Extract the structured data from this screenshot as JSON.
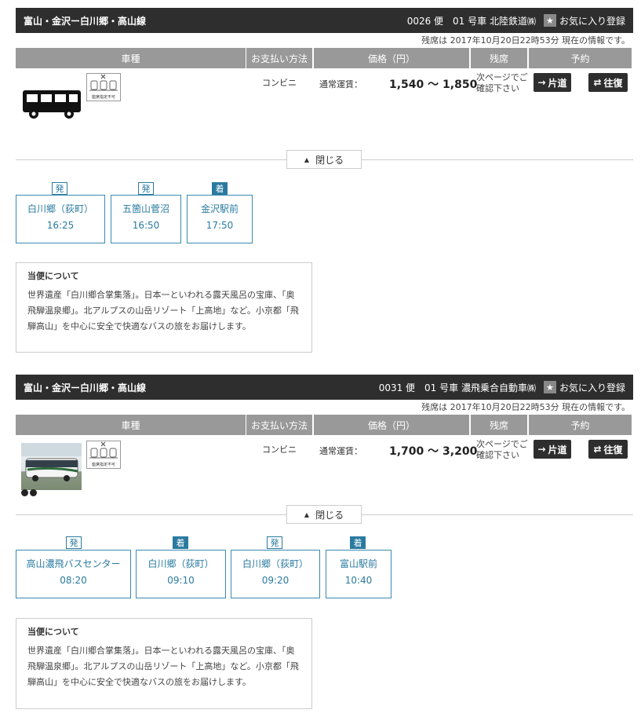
{
  "common": {
    "fav_label": "お気に入り登録",
    "fav_star": "★",
    "col_vehicle": "車種",
    "col_payment": "お支払い方法",
    "col_price": "価格（円）",
    "col_seats": "残席",
    "col_booking": "予約",
    "payment": "コンビニ",
    "fare_label": "通常運賃：",
    "seat_note": "次ページでご確認下さい",
    "oneway_label": "片道",
    "roundtrip_label": "往復",
    "close_label": "閉じる",
    "seat_icon_text": "座席指定不可",
    "about_title": "当便について",
    "about_text": "世界遺産「白川郷合掌集落」。日本一といわれる露天風呂の宝庫、「奥飛騨温泉郷」。北アルプスの山岳リゾート「上高地」など。小京都「飛騨高山」を中心に安全で快適なバスの旅をお届けします。",
    "depart_badge": "発",
    "arrive_badge": "着"
  },
  "results": [
    {
      "route": "富山・金沢ー白川郷・高山線",
      "train_info": "0026 便　01 号車",
      "operator": "北陸鉄道",
      "operator_suffix": "㈱",
      "seat_status": "残席は 2017年10月20日22時53分 現在の情報です。",
      "fare_range": "1,540 〜 1,850",
      "stops": [
        {
          "type": "発",
          "name": "白川郷（荻町）",
          "time": "16:25"
        },
        {
          "type": "発",
          "name": "五箇山菅沼",
          "time": "16:50"
        },
        {
          "type": "着",
          "name": "金沢駅前",
          "time": "17:50"
        }
      ]
    },
    {
      "route": "富山・金沢ー白川郷・高山線",
      "train_info": "0031 便　01 号車",
      "operator": "濃飛乗合自動車",
      "operator_suffix": "㈱",
      "seat_status": "残席は 2017年10月20日22時53分 現在の情報です。",
      "fare_range": "1,700 〜 3,200",
      "stops": [
        {
          "type": "発",
          "name": "高山濃飛バスセンター",
          "time": "08:20"
        },
        {
          "type": "着",
          "name": "白川郷（荻町）",
          "time": "09:10"
        },
        {
          "type": "発",
          "name": "白川郷（荻町）",
          "time": "09:20"
        },
        {
          "type": "着",
          "name": "富山駅前",
          "time": "10:40"
        }
      ]
    }
  ]
}
